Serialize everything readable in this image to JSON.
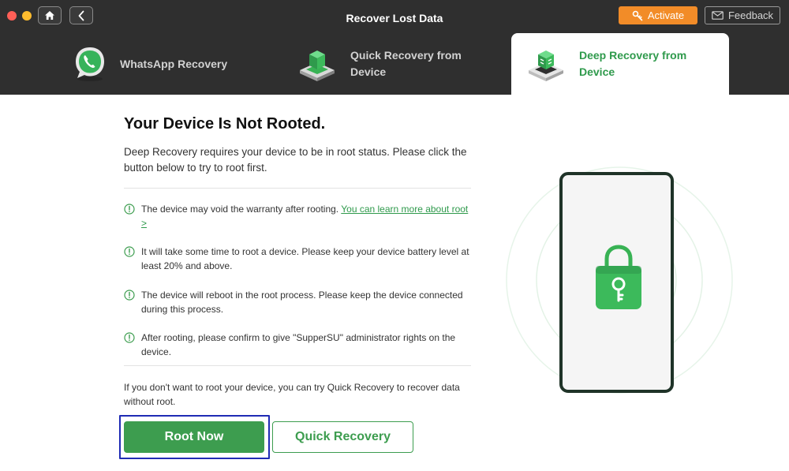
{
  "window": {
    "title": "Recover Lost Data"
  },
  "header": {
    "activate_label": "Activate",
    "feedback_label": "Feedback"
  },
  "tabs": [
    {
      "label_line1": "WhatsApp Recovery",
      "label_line2": "",
      "icon": "whatsapp-phone-icon",
      "active": false
    },
    {
      "label_line1": "Quick Recovery from",
      "label_line2": "Device",
      "icon": "device-box-icon",
      "active": false
    },
    {
      "label_line1": "Deep Recovery from",
      "label_line2": "Device",
      "icon": "device-deep-icon",
      "active": true
    }
  ],
  "main": {
    "title": "Your Device Is Not Rooted.",
    "description": "Deep Recovery requires your device to be in root status. Please click the button below to try to root first.",
    "notices": [
      {
        "text": "The device may void the warranty after rooting. ",
        "link": "You can learn more about root >",
        "icon": "alert-circle-icon"
      },
      {
        "text": "It will take some time to root a device. Please keep your device battery level at least 20% and above.",
        "icon": "alert-circle-icon"
      },
      {
        "text": "The device will reboot in the root process. Please keep the device connected during this process.",
        "icon": "alert-circle-icon"
      },
      {
        "text": "After rooting, please confirm to give \"SupperSU\" administrator rights on the device.",
        "icon": "alert-circle-icon"
      }
    ],
    "alternative_text": "If you don't want to root your device, you can try Quick Recovery to recover data without root.",
    "root_button_label": "Root Now",
    "quick_button_label": "Quick Recovery"
  },
  "colors": {
    "header_bg": "#2f2f2f",
    "accent_green": "#3d9d4f",
    "activate_orange": "#f28c28",
    "focus_blue": "#1f2bb4"
  }
}
